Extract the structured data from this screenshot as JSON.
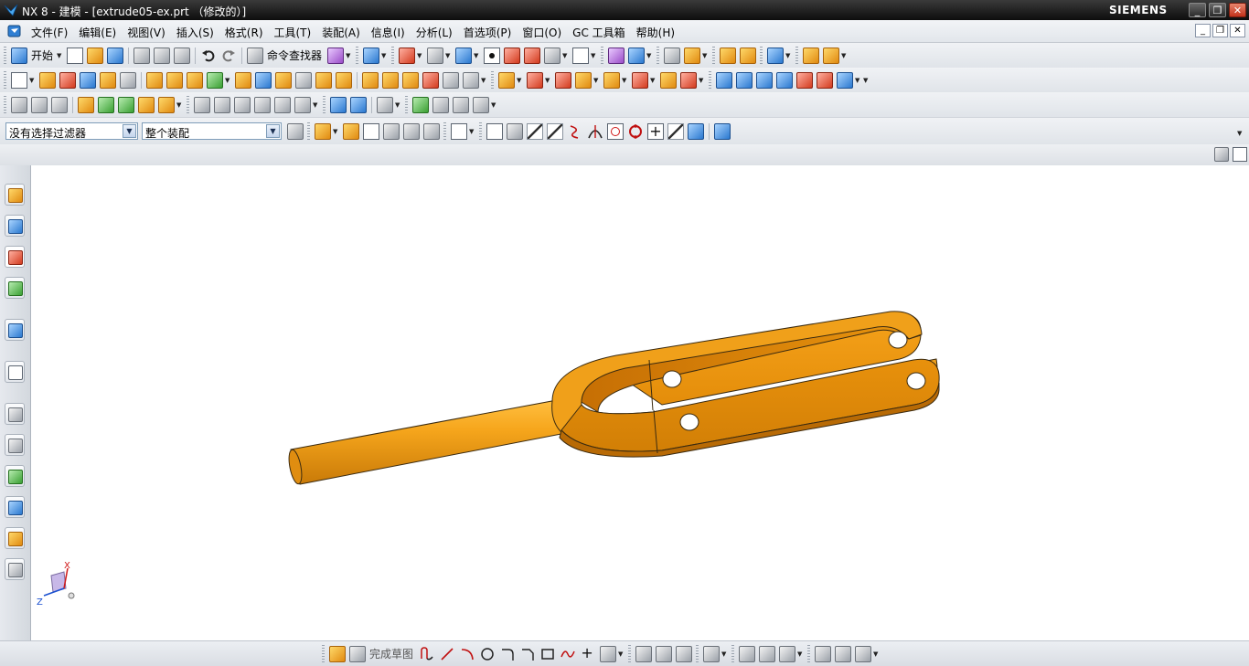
{
  "window": {
    "title": "NX 8 - 建模 - [extrude05-ex.prt （修改的）]",
    "brand": "SIEMENS",
    "controls": {
      "minimize": "_",
      "maximize": "❐",
      "close": "✕"
    }
  },
  "menubar": {
    "items": [
      {
        "label": "文件(F)"
      },
      {
        "label": "编辑(E)"
      },
      {
        "label": "视图(V)"
      },
      {
        "label": "插入(S)"
      },
      {
        "label": "格式(R)"
      },
      {
        "label": "工具(T)"
      },
      {
        "label": "装配(A)"
      },
      {
        "label": "信息(I)"
      },
      {
        "label": "分析(L)"
      },
      {
        "label": "首选项(P)"
      },
      {
        "label": "窗口(O)"
      },
      {
        "label": "GC 工具箱"
      },
      {
        "label": "帮助(H)"
      }
    ],
    "doc_controls": {
      "minimize": "_",
      "restore": "❐",
      "close": "✕"
    }
  },
  "toolbar_standard": {
    "start_label": "开始",
    "command_finder_label": "命令查找器"
  },
  "selection_bar": {
    "type_filter": "没有选择过滤器",
    "scope_filter": "整个装配"
  },
  "sketch_toolbar": {
    "finish_sketch_label": "完成草图"
  },
  "triad": {
    "x_label": "X",
    "z_label": "Z"
  },
  "colors": {
    "part_body": "#e8900a",
    "part_highlight": "#f8b030",
    "part_shadow": "#b86a05",
    "edge": "#3a2a10"
  }
}
